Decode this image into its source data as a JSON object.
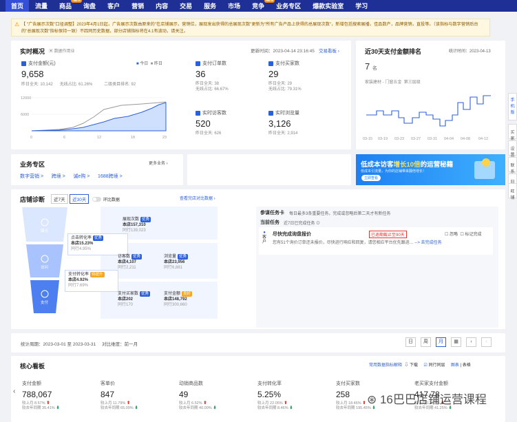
{
  "nav": {
    "items": [
      "首页",
      "流量",
      "商品",
      "询盘",
      "客户",
      "营销",
      "内容",
      "交易",
      "服务",
      "市场",
      "竞争",
      "业务专区",
      "爆款实验室",
      "学习"
    ],
    "new_badge": "NEW"
  },
  "notice": {
    "text": "【 \"广告展示次数\"口径调整】2023年4月1日起，广告展示次数由原来的\"在店铺展示，营销位，展现发出获得的总展现次数\"更新为\"所有广告产品上获得的总展现次数\"，新增包括搜索展播，佳品数产，品牌营销，直投等。（该指标与数字营销后台的\"总展现次数\"指标保持一致）不四同历史数据，部分店铺指标将在4.1有波动，请关注。"
  },
  "realtime": {
    "title": "实时概况",
    "doc_link": "数据作用业",
    "update": "更新时间：2023-04-14 23:16:45",
    "trade_link": "交易看板 ›",
    "pay_amount": {
      "label": "支付金额(元)",
      "value": "9,658",
      "yesterday": "昨日全天: 10,142",
      "ratio": "无线占比: 61.26%",
      "rank": "二级类目排名: 92"
    },
    "legend_today": "今日",
    "legend_yday": "昨日",
    "chart_y": [
      "12000",
      "6000"
    ],
    "chart_x": [
      "0",
      "6",
      "12",
      "18",
      "23"
    ],
    "orders": {
      "label": "支付订单数",
      "value": "36",
      "yesterday": "昨日全天: 38",
      "ratio": "无线占比: 66.67%"
    },
    "buyers": {
      "label": "支付买家数",
      "value": "29",
      "yesterday": "昨日全天: 29",
      "ratio": "无线占比: 79.31%"
    },
    "visitors": {
      "label": "实时访客数",
      "value": "520",
      "yesterday": "昨日全天: 626"
    },
    "pageviews": {
      "label": "实时浏览量",
      "value": "3,126",
      "yesterday": "昨日全天: 2,914"
    }
  },
  "ranking": {
    "title": "近30天支付金额排名",
    "time": "统计时间：2023-04-13",
    "rank": "7",
    "unit": "名",
    "cat": "家装建材 - 门窗五金",
    "tier": "第三层级",
    "x": [
      "03-15",
      "03-19",
      "03-23",
      "03-27",
      "03-31",
      "04-04",
      "04-08",
      "04-12"
    ]
  },
  "biz": {
    "title": "业务专区",
    "more": "更多业务 ›",
    "links": [
      "数字营销 >",
      "跨境 >",
      "诚e购 >",
      "1688跨境 >"
    ]
  },
  "banner": {
    "main": "低成本访客",
    "highlight": "增长10倍",
    "tail": "的运营秘籍",
    "sub": "低成本引流量，为你的店铺带来翻倍增长！",
    "btn": "立即查看"
  },
  "diag": {
    "title": "店铺诊断",
    "p7": "近7天",
    "p30": "近30天",
    "compare": "环比数据",
    "view_link": "查看完店对比数据 ›",
    "funnel": [
      "曝光",
      "访问",
      "支付"
    ],
    "exposure": {
      "label": "展现次数",
      "tag": "优秀",
      "store": "本店157,310",
      "peer": "同行139,023"
    },
    "click": {
      "label": "点击转化率",
      "tag": "优秀",
      "store": "本店15.23%",
      "peer": "同行4.95%"
    },
    "visits": {
      "label": "访客数",
      "tag": "优秀",
      "store": "本店4,107",
      "peer": "同行2,211"
    },
    "browse": {
      "label": "浏览量",
      "tag": "优秀",
      "store": "本店23,956",
      "peer": "同行6,881"
    },
    "payconv": {
      "label": "支付转化率",
      "tag": "待提升",
      "store": "本店4.92%",
      "peer": "同行7.69%"
    },
    "paybuyers": {
      "label": "支付买家数",
      "tag": "优秀",
      "store": "本店202",
      "peer": "同行170"
    },
    "payamt": {
      "label": "支付金额",
      "tag": "良好",
      "store": "本店148,792",
      "peer": "同行300,660"
    }
  },
  "tasks": {
    "title": "参谋任务卡",
    "desc": "每日最多3条重要任务，完成或忽略后第二天才有新任务",
    "current": "当前任务",
    "done": "近7日已完成任务 ⊙",
    "cust_label": "客户",
    "item_title": "尽快完成询盘报价",
    "item_tag": "已逾期截止至90天",
    "item_desc": "您有51个询价订单还未报价，尽快进行响应和回复，请您相应平台优先跟进…",
    "go": "--> 去完成任务",
    "ignore": "忽略",
    "mark": "标记完成"
  },
  "period": {
    "range": "统计周期：2023-03-01 至 2023-03-31",
    "cmp": "对比维度：前一月",
    "btns": [
      "日",
      "周",
      "月"
    ]
  },
  "board": {
    "title": "核心看板",
    "link": "常用数据指标解释",
    "download": "下载",
    "cycle": "同行同层",
    "view1": "图表",
    "view2": "表格",
    "metrics": [
      {
        "label": "支付金额",
        "value": "788,067",
        "a": "较上月 8.57%",
        "b": "较去年同期 35.41%"
      },
      {
        "label": "客单价",
        "value": "847",
        "a": "较上月 11.79%",
        "b": "较去年同期 65.09%"
      },
      {
        "label": "动销商品数",
        "value": "49",
        "a": "较上月 6.52%",
        "b": "较去年同期 40.00%"
      },
      {
        "label": "支付转化率",
        "value": "5.25%",
        "a": "较上月 22.05%",
        "b": "较去年同期 8.46%"
      },
      {
        "label": "支付买家数",
        "value": "258",
        "a": "较上月 18.46%",
        "b": "较去年同期 195.45%"
      },
      {
        "label": "老买家支付金额",
        "value": "417.78",
        "a": "较上月 12.37%",
        "b": "较去年同期 41.25%"
      }
    ]
  },
  "watermark": "16巴巴店铺运营课程",
  "side": [
    "手机版",
    "买家",
    "设置",
    "联系",
    "旧版",
    "旺铺"
  ]
}
